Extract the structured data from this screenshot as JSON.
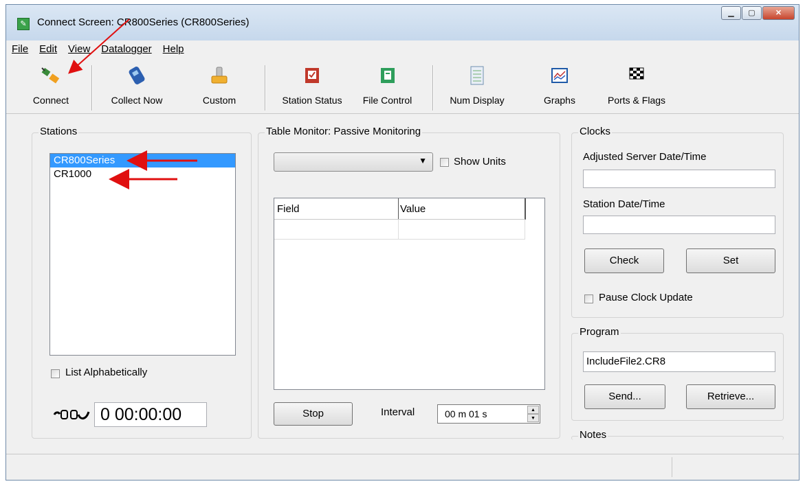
{
  "window": {
    "title": "Connect Screen: CR800Series (CR800Series)"
  },
  "menu": [
    "File",
    "Edit",
    "View",
    "Datalogger",
    "Help"
  ],
  "toolbar": {
    "connect": "Connect",
    "collect_now": "Collect Now",
    "custom": "Custom",
    "station_status": "Station Status",
    "file_control": "File Control",
    "num_display": "Num Display",
    "graphs": "Graphs",
    "ports_flags": "Ports & Flags"
  },
  "stations": {
    "label": "Stations",
    "items": [
      "CR800Series",
      "CR1000"
    ],
    "selected": "CR800Series",
    "list_alphabetically": "List Alphabetically",
    "timer": "0 00:00:00"
  },
  "table_monitor": {
    "label": "Table Monitor: Passive Monitoring",
    "table_selected": "",
    "show_units": "Show Units",
    "columns": [
      "Field",
      "Value"
    ],
    "stop": "Stop",
    "interval_label": "Interval",
    "interval_value": "00 m 01 s"
  },
  "clocks": {
    "label": "Clocks",
    "server_label": "Adjusted Server Date/Time",
    "server_value": "",
    "station_label": "Station Date/Time",
    "station_value": "",
    "check": "Check",
    "set": "Set",
    "pause": "Pause Clock Update"
  },
  "program": {
    "label": "Program",
    "file": "IncludeFile2.CR8",
    "send": "Send...",
    "retrieve": "Retrieve..."
  },
  "notes": {
    "label": "Notes"
  },
  "colors": {
    "selection": "#3399ff",
    "annotation_arrow": "#e01010"
  }
}
